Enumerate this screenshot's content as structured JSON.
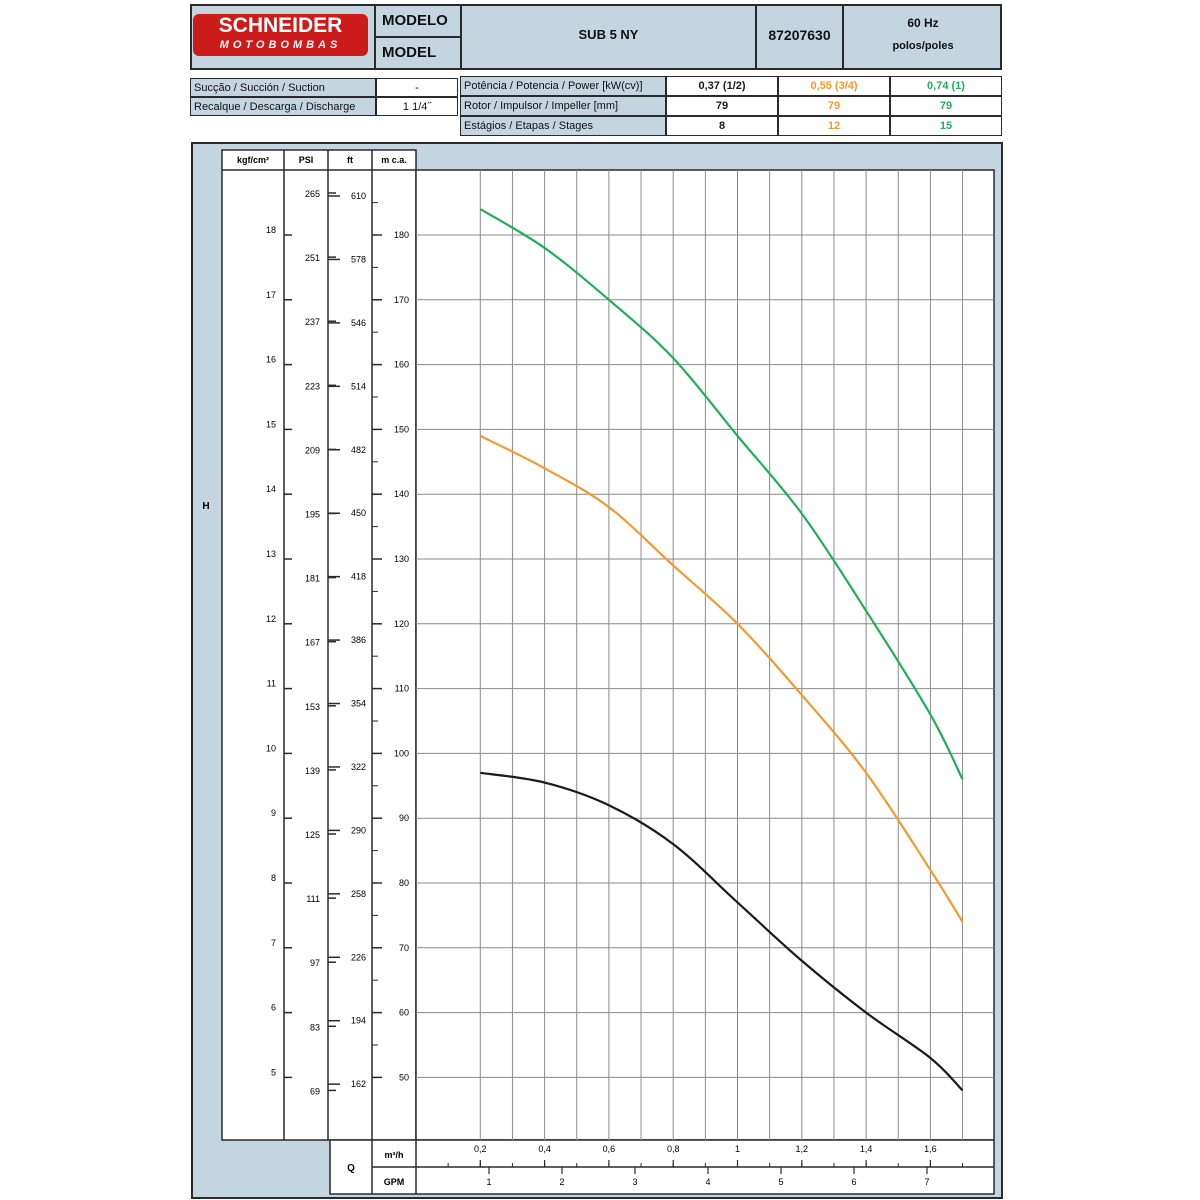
{
  "header": {
    "brand_top": "SCHNEIDER",
    "brand_bottom": "MOTOBOMBAS",
    "model_label_pt": "MODELO",
    "model_label_en": "MODEL",
    "model_name": "SUB 5 NY",
    "code": "87207630",
    "frequency": "60 Hz",
    "poles_label": "polos/poles"
  },
  "specs": {
    "suction_label": "Sucção / Succión / Suction",
    "suction_value": "-",
    "discharge_label": "Recalque / Descarga / Discharge",
    "discharge_value": "1 1/4˝",
    "power_label": "Potência / Potencia / Power [kW(cv)]",
    "impeller_label": "Rotor / Impulsor / Impeller [mm]",
    "stages_label": "Estágios / Etapas / Stages",
    "columns": [
      {
        "power": "0,37 (1/2)",
        "impeller": "79",
        "stages": "8",
        "color": "#1a1a1a"
      },
      {
        "power": "0,55 (3/4)",
        "impeller": "79",
        "stages": "12",
        "color": "#f29a2e"
      },
      {
        "power": "0,74 (1)",
        "impeller": "79",
        "stages": "15",
        "color": "#1fae5a"
      }
    ]
  },
  "axes": {
    "h_label": "H",
    "q_label": "Q",
    "kgf_header": "kgf/cm²",
    "psi_header": "PSI",
    "ft_header": "ft",
    "mca_header": "m c.a.",
    "m3h_label": "m³/h",
    "gpm_label": "GPM",
    "kgf_ticks": [
      "18",
      "17",
      "16",
      "15",
      "14",
      "13",
      "12",
      "11",
      "10",
      "9",
      "8",
      "7",
      "6",
      "5"
    ],
    "psi_ticks": [
      "265",
      "251",
      "237",
      "223",
      "209",
      "195",
      "181",
      "167",
      "153",
      "139",
      "125",
      "111",
      "97",
      "83",
      "69"
    ],
    "ft_ticks": [
      "610",
      "578",
      "546",
      "514",
      "482",
      "450",
      "418",
      "386",
      "354",
      "322",
      "290",
      "258",
      "226",
      "194",
      "162"
    ],
    "mca_ticks": [
      "180",
      "170",
      "160",
      "150",
      "140",
      "130",
      "120",
      "110",
      "100",
      "90",
      "80",
      "70",
      "60",
      "50"
    ],
    "m3h_ticks": [
      "0,2",
      "0,4",
      "0,6",
      "0,8",
      "1",
      "1,2",
      "1,4",
      "1,6"
    ],
    "gpm_ticks": [
      "1",
      "2",
      "3",
      "4",
      "5",
      "6",
      "7"
    ]
  },
  "chart_data": {
    "type": "line",
    "xlabel": "Q",
    "ylabel": "H",
    "x_unit": "m³/h",
    "y_unit": "m c.a.",
    "xlim": [
      0,
      1.8
    ],
    "ylim": [
      43,
      190
    ],
    "grid": true,
    "series": [
      {
        "name": "0,37 (1/2)",
        "color": "#1a1a1a",
        "x": [
          0.2,
          0.4,
          0.6,
          0.8,
          1.0,
          1.2,
          1.4,
          1.6,
          1.7
        ],
        "y": [
          97,
          95.5,
          92,
          86,
          77,
          68,
          60,
          53,
          48
        ]
      },
      {
        "name": "0,55 (3/4)",
        "color": "#f29a2e",
        "x": [
          0.2,
          0.4,
          0.6,
          0.8,
          1.0,
          1.2,
          1.4,
          1.6,
          1.7
        ],
        "y": [
          149,
          144,
          138,
          129,
          120,
          109,
          97,
          82,
          74
        ]
      },
      {
        "name": "0,74 (1)",
        "color": "#1fae5a",
        "x": [
          0.2,
          0.4,
          0.6,
          0.8,
          1.0,
          1.2,
          1.4,
          1.6,
          1.7
        ],
        "y": [
          184,
          178,
          170,
          161,
          149,
          137,
          122,
          106,
          96
        ]
      }
    ]
  }
}
